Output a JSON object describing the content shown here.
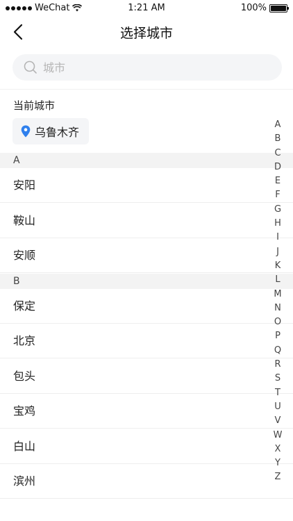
{
  "status_bar": {
    "carrier": "WeChat",
    "time": "1:21 AM",
    "battery": "100%",
    "battery_level": 1.0
  },
  "nav": {
    "title": "选择城市",
    "back_icon": "chevron-left-icon"
  },
  "search": {
    "placeholder": "城市",
    "value": "",
    "icon": "search-icon"
  },
  "current_city": {
    "title": "当前城市",
    "name": "乌鲁木齐",
    "icon": "location-pin-icon",
    "icon_color": "#2f80ed"
  },
  "sections": [
    {
      "letter": "A",
      "cities": [
        "安阳",
        "鞍山",
        "安顺"
      ]
    },
    {
      "letter": "B",
      "cities": [
        "保定",
        "北京",
        "包头",
        "宝鸡",
        "白山",
        "滨州"
      ]
    }
  ],
  "alphabet": [
    "A",
    "B",
    "C",
    "D",
    "E",
    "F",
    "G",
    "H",
    "I",
    "J",
    "K",
    "L",
    "M",
    "N",
    "O",
    "P",
    "Q",
    "R",
    "S",
    "T",
    "U",
    "V",
    "W",
    "X",
    "Y",
    "Z"
  ]
}
